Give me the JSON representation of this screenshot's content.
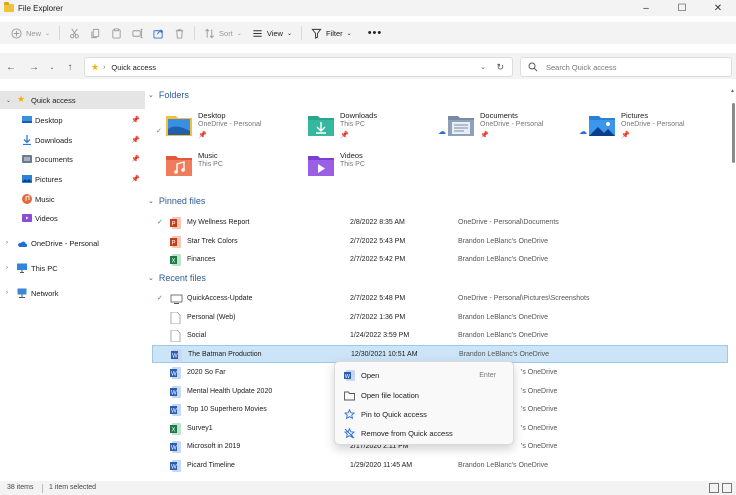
{
  "window": {
    "title": "File Explorer"
  },
  "commandbar": {
    "new_label": "New",
    "sort_label": "Sort",
    "view_label": "View",
    "filter_label": "Filter"
  },
  "address": {
    "path": "Quick access"
  },
  "search": {
    "placeholder": "Search Quick access"
  },
  "sidebar": {
    "items": [
      {
        "label": "Quick access"
      },
      {
        "label": "Desktop"
      },
      {
        "label": "Downloads"
      },
      {
        "label": "Documents"
      },
      {
        "label": "Pictures"
      },
      {
        "label": "Music"
      },
      {
        "label": "Videos"
      },
      {
        "label": "OneDrive - Personal"
      },
      {
        "label": "This PC"
      },
      {
        "label": "Network"
      }
    ]
  },
  "folders": {
    "header": "Folders",
    "items": [
      {
        "name": "Desktop",
        "sub": "OneDrive - Personal",
        "status": "synced",
        "pinned": true
      },
      {
        "name": "Downloads",
        "sub": "This PC",
        "pinned": true
      },
      {
        "name": "Documents",
        "sub": "OneDrive - Personal",
        "status": "cloud",
        "pinned": true
      },
      {
        "name": "Pictures",
        "sub": "OneDrive - Personal",
        "status": "cloud",
        "pinned": true
      },
      {
        "name": "Music",
        "sub": "This PC"
      },
      {
        "name": "Videos",
        "sub": "This PC"
      }
    ]
  },
  "pinned": {
    "header": "Pinned files",
    "rows": [
      {
        "name": "My Wellness Report",
        "date": "2/8/2022 8:35 AM",
        "location": "OneDrive - Personal\\Documents",
        "status": "synced",
        "type": "ppt"
      },
      {
        "name": "Star Trek Colors",
        "date": "2/7/2022 5:43 PM",
        "location": "Brandon LeBlanc's OneDrive",
        "type": "ppt"
      },
      {
        "name": "Finances",
        "date": "2/7/2022 5:42 PM",
        "location": "Brandon LeBlanc's OneDrive",
        "type": "xls"
      }
    ]
  },
  "recent": {
    "header": "Recent files",
    "rows": [
      {
        "name": "QuickAccess-Update",
        "date": "2/7/2022 5:48 PM",
        "location": "OneDrive - Personal\\Pictures\\Screenshots",
        "status": "synced",
        "type": "img"
      },
      {
        "name": "Personal (Web)",
        "date": "2/7/2022 1:36 PM",
        "location": "Brandon LeBlanc's OneDrive",
        "type": "blank"
      },
      {
        "name": "Social",
        "date": "1/24/2022 3:59 PM",
        "location": "Brandon LeBlanc's OneDrive",
        "type": "blank"
      },
      {
        "name": "The Batman Production",
        "date": "12/30/2021 10:51 AM",
        "location": "Brandon LeBlanc's OneDrive",
        "type": "doc",
        "selected": true
      },
      {
        "name": "2020 So Far",
        "date": "",
        "location": "'s OneDrive",
        "type": "doc"
      },
      {
        "name": "Mental Health Update 2020",
        "date": "",
        "location": "'s OneDrive",
        "type": "doc"
      },
      {
        "name": "Top 10 Superhero Movies",
        "date": "",
        "location": "'s OneDrive",
        "type": "doc"
      },
      {
        "name": "Survey1",
        "date": "",
        "location": "'s OneDrive",
        "type": "xls"
      },
      {
        "name": "Microsoft in 2019",
        "date": "2/17/2020 2:11 PM",
        "location": "'s OneDrive",
        "type": "doc"
      },
      {
        "name": "Picard Timeline",
        "date": "1/29/2020 11:45 AM",
        "location": "Brandon LeBlanc's OneDrive",
        "type": "doc"
      }
    ]
  },
  "context_menu": {
    "items": [
      {
        "label": "Open",
        "shortcut": "Enter",
        "icon": "word-icon"
      },
      {
        "label": "Open file location",
        "icon": "folder-icon"
      },
      {
        "label": "Pin to Quick access",
        "icon": "pin-icon"
      },
      {
        "label": "Remove from Quick access",
        "icon": "star-remove-icon"
      }
    ]
  },
  "statusbar": {
    "count": "38 items",
    "selected": "1 item selected"
  },
  "colors": {
    "accent": "#2b5a9b",
    "selection": "#cce4f7",
    "sidebar_selected": "#e5e5e5",
    "synced_green": "#2e9e44",
    "cloud_blue": "#2b6ed6"
  }
}
